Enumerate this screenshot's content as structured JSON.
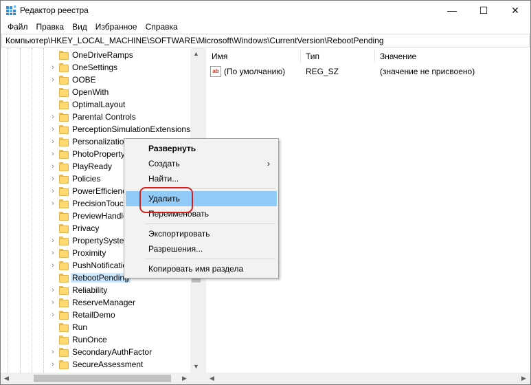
{
  "window": {
    "title": "Редактор реестра",
    "controls": {
      "minimize": "—",
      "maximize": "☐",
      "close": "✕"
    }
  },
  "menu": [
    "Файл",
    "Правка",
    "Вид",
    "Избранное",
    "Справка"
  ],
  "address": "Компьютер\\HKEY_LOCAL_MACHINE\\SOFTWARE\\Microsoft\\Windows\\CurrentVersion\\RebootPending",
  "tree": {
    "selected": "RebootPending",
    "items": [
      {
        "label": "OneDriveRamps",
        "expandable": false
      },
      {
        "label": "OneSettings",
        "expandable": true
      },
      {
        "label": "OOBE",
        "expandable": true
      },
      {
        "label": "OpenWith",
        "expandable": false
      },
      {
        "label": "OptimalLayout",
        "expandable": false
      },
      {
        "label": "Parental Controls",
        "expandable": true
      },
      {
        "label": "PerceptionSimulationExtensions",
        "expandable": true
      },
      {
        "label": "Personalization",
        "expandable": true
      },
      {
        "label": "PhotoProperty",
        "expandable": true
      },
      {
        "label": "PlayReady",
        "expandable": true
      },
      {
        "label": "Policies",
        "expandable": true
      },
      {
        "label": "PowerEfficienc",
        "expandable": true
      },
      {
        "label": "PrecisionTouch",
        "expandable": true
      },
      {
        "label": "PreviewHandle",
        "expandable": false
      },
      {
        "label": "Privacy",
        "expandable": false
      },
      {
        "label": "PropertySyster",
        "expandable": true
      },
      {
        "label": "Proximity",
        "expandable": true
      },
      {
        "label": "PushNotificatio",
        "expandable": true
      },
      {
        "label": "RebootPending",
        "expandable": false
      },
      {
        "label": "Reliability",
        "expandable": true
      },
      {
        "label": "ReserveManager",
        "expandable": true
      },
      {
        "label": "RetailDemo",
        "expandable": true
      },
      {
        "label": "Run",
        "expandable": false
      },
      {
        "label": "RunOnce",
        "expandable": false
      },
      {
        "label": "SecondaryAuthFactor",
        "expandable": true
      },
      {
        "label": "SecureAssessment",
        "expandable": true
      }
    ]
  },
  "values": {
    "columns": {
      "name": "Имя",
      "type": "Тип",
      "value": "Значение"
    },
    "rows": [
      {
        "name": "(По умолчанию)",
        "type": "REG_SZ",
        "data": "(значение не присвоено)",
        "icon": "ab"
      }
    ]
  },
  "context_menu": {
    "expand": "Развернуть",
    "create": "Создать",
    "find": "Найти...",
    "delete": "Удалить",
    "rename": "Переименовать",
    "export": "Экспортировать",
    "permissions": "Разрешения...",
    "copy_key_name": "Копировать имя раздела"
  },
  "colors": {
    "menu_highlight": "#91c9f7",
    "tree_selection": "#cce8ff",
    "annotation": "#d62020",
    "folder": "#ffd970"
  }
}
